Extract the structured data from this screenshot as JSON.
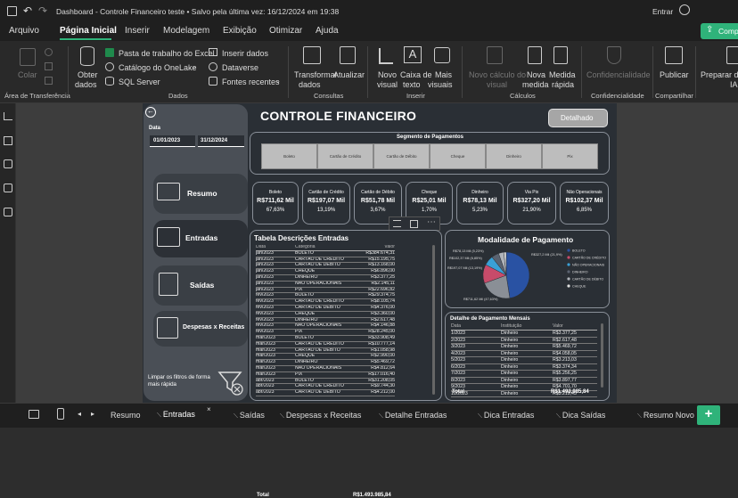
{
  "titlebar": {
    "title": "Dashboard - Controle Financeiro teste  •  Salvo pela última vez: 16/12/2024 em 19:38",
    "signin": "Entrar"
  },
  "menu": {
    "items": [
      "Arquivo",
      "Página Inicial",
      "Inserir",
      "Modelagem",
      "Exibição",
      "Otimizar",
      "Ajuda"
    ],
    "active": "Página Inicial",
    "share": "Comp"
  },
  "ribbon": {
    "paste": "Colar",
    "clipboard_group": "Área de Transferência",
    "get_data": "Obter",
    "get_data2": "dados",
    "excel": "Pasta de trabalho do Excel",
    "onelake": "Catálogo do OneLake",
    "sql": "SQL Server",
    "insert_data": "Inserir dados",
    "dataverse": "Dataverse",
    "recent": "Fontes recentes",
    "data_group": "Dados",
    "transform": "Transformar",
    "transform2": "dados",
    "refresh": "Atualizar",
    "queries_group": "Consultas",
    "new_visual": "Novo",
    "new_visual2": "visual",
    "textbox": "Caixa de",
    "textbox2": "texto",
    "more": "Mais",
    "more2": "visuais",
    "insert_group": "Inserir",
    "new_calc": "Novo cálculo do",
    "new_calc2": "visual",
    "new_measure": "Nova",
    "new_measure2": "medida",
    "quick_measure": "Medida",
    "quick_measure2": "rápida",
    "calc_group": "Cálculos",
    "sensitivity": "Confidencialidade",
    "sens_group": "Confidencialidade",
    "publish": "Publicar",
    "share_group": "Compartilhar",
    "prepare": "Preparar da",
    "prepare2": "IA"
  },
  "report": {
    "title": "CONTROLE FINANCEIRO",
    "detail_button": "Detalhado",
    "date_label": "Data",
    "date_from": "01/01/2023",
    "date_to": "31/12/2024",
    "nav": [
      "Resumo",
      "Entradas",
      "Saídas",
      "Despesas x Receitas"
    ],
    "clear_filters": "Limpar os filtros de forma mais rápida",
    "segment_title": "Segmento de Pagamentos",
    "segments": [
      "Boleto",
      "Cartão de Crédito",
      "Cartão de Débito",
      "Cheque",
      "Dinheiro",
      "Pix"
    ],
    "cards": [
      {
        "label": "Boleto",
        "value": "R$711,62 Mil",
        "pct": "67,63%"
      },
      {
        "label": "Cartão de Crédito",
        "value": "R$197,07 Mil",
        "pct": "13,19%"
      },
      {
        "label": "Cartão de Débito",
        "value": "R$51,78 Mil",
        "pct": "3,67%"
      },
      {
        "label": "Cheque",
        "value": "R$25,01 Mil",
        "pct": "1,70%"
      },
      {
        "label": "Dinheiro",
        "value": "R$78,13 Mil",
        "pct": "5,23%"
      },
      {
        "label": "Via Pix",
        "value": "R$327,20 Mil",
        "pct": "21,90%"
      },
      {
        "label": "Não Operacionais",
        "value": "R$102,37 Mil",
        "pct": "6,85%"
      }
    ],
    "table_title": "Tabela Descrições Entradas",
    "table_headers": [
      "Data",
      "Categoria",
      "Valor"
    ],
    "table_rows": [
      [
        "jan/2023",
        "BOLETO",
        "R$384.674,31"
      ],
      [
        "jan/2023",
        "CARTÃO DE CRÉDITO",
        "R$15.195,75"
      ],
      [
        "jan/2023",
        "CARTÃO DE DÉBITO",
        "R$13.168,00"
      ],
      [
        "jan/2023",
        "CHEQUE",
        "R$6.896,00"
      ],
      [
        "jan/2023",
        "DINHEIRO",
        "R$3.377,25"
      ],
      [
        "jan/2023",
        "NÃO OPERACIONAIS",
        "R$2.145,11"
      ],
      [
        "jan/2023",
        "PIX",
        "R$22.696,82"
      ],
      [
        "fev/2023",
        "BOLETO",
        "R$29.374,75"
      ],
      [
        "fev/2023",
        "CARTÃO DE CRÉDITO",
        "R$8.105,74"
      ],
      [
        "fev/2023",
        "CARTÃO DE DÉBITO",
        "R$4.376,00"
      ],
      [
        "fev/2023",
        "CHEQUE",
        "R$3.360,00"
      ],
      [
        "fev/2023",
        "DINHEIRO",
        "R$2.617,48"
      ],
      [
        "fev/2023",
        "NÃO OPERACIONAIS",
        "R$4.146,88"
      ],
      [
        "fev/2023",
        "PIX",
        "R$28.245,00"
      ],
      [
        "mar/2023",
        "BOLETO",
        "R$33.908,49"
      ],
      [
        "mar/2023",
        "CARTÃO DE CRÉDITO",
        "R$10.777,14"
      ],
      [
        "mar/2023",
        "CARTÃO DE DÉBITO",
        "R$1.058,98"
      ],
      [
        "mar/2023",
        "CHEQUE",
        "R$2.990,00"
      ],
      [
        "mar/2023",
        "DINHEIRO",
        "R$5.469,72"
      ],
      [
        "mar/2023",
        "NÃO OPERACIONAIS",
        "R$4.812,64"
      ],
      [
        "mar/2023",
        "PIX",
        "R$17.016,40"
      ],
      [
        "abr/2023",
        "BOLETO",
        "R$31.208,05"
      ],
      [
        "abr/2023",
        "CARTÃO DE CRÉDITO",
        "R$9.744,30"
      ],
      [
        "abr/2023",
        "CARTÃO DE DÉBITO",
        "R$4.212,00"
      ]
    ],
    "table_total_label": "Total",
    "table_total": "R$1.493.985,84",
    "pie_title": "Modalidade de Pagamento",
    "pie_legend": [
      "BOLETO",
      "CARTÃO DE CRÉDITO",
      "NÃO OPERACIONAIS",
      "DINHEIRO",
      "CARTÃO DE DÉBITO",
      "CHEQUE"
    ],
    "pie_labels": [
      "R$78,13 Mil (5,23%)",
      "R$102,37 Mil (6,85%)",
      "R$197,07 Mil (13,19%)",
      "R$711,62 Mil (47,63%)",
      "R$327,2 Mil (21,9%)"
    ],
    "monthly_title": "Detalhe de Pagamento Mensais",
    "monthly_headers": [
      "Data",
      "Instituição",
      "Valor"
    ],
    "monthly_rows": [
      [
        "1/2023",
        "Dinheiro",
        "R$3.377,25"
      ],
      [
        "2/2023",
        "Dinheiro",
        "R$2.617,48"
      ],
      [
        "3/2023",
        "Dinheiro",
        "R$5.469,72"
      ],
      [
        "4/2023",
        "Dinheiro",
        "R$4.058,05"
      ],
      [
        "5/2023",
        "Dinheiro",
        "R$3.213,03"
      ],
      [
        "6/2023",
        "Dinheiro",
        "R$3.374,34"
      ],
      [
        "7/2023",
        "Dinheiro",
        "R$5.256,25"
      ],
      [
        "8/2023",
        "Dinheiro",
        "R$3.897,77"
      ],
      [
        "9/2023",
        "Dinheiro",
        "R$4.701,70"
      ],
      [
        "10/2023",
        "Dinheiro",
        "R$3.219,45"
      ]
    ],
    "monthly_total_label": "Total",
    "monthly_total": "R$1.493.985,84"
  },
  "pages": [
    "Resumo",
    "Entradas",
    "Saídas",
    "Despesas x Receitas",
    "Detalhe Entradas",
    "Dica Entradas",
    "Dica Saídas",
    "Resumo Novo"
  ],
  "active_page": "Entradas",
  "colors": {
    "accent": "#2fb37a",
    "pie_boleto": "#2952a3",
    "pie_pix": "#8a8f96",
    "pie_credit": "#c74b6a",
    "pie_noop": "#3aa0d6",
    "pie_cash": "#5a6270"
  }
}
